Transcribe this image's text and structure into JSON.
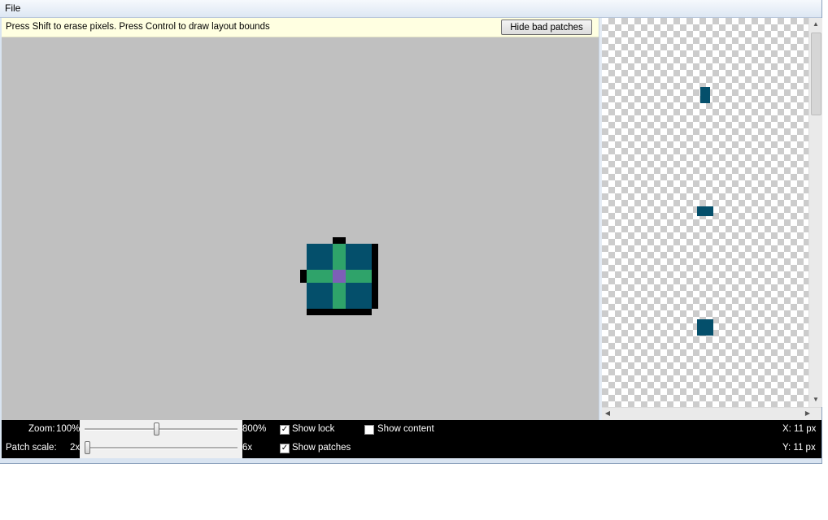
{
  "menu": {
    "file": "File"
  },
  "hint": {
    "text": "Press Shift to erase pixels. Press Control to draw layout bounds",
    "hide_bad_patches": "Hide bad patches"
  },
  "status": {
    "zoom_label": "Zoom:",
    "zoom_min": "100%",
    "zoom_max": "800%",
    "zoom_value_fraction": 0.47,
    "patch_scale_label": "Patch scale:",
    "patch_min": "2x",
    "patch_max": "6x",
    "patch_value_fraction": 0.0,
    "show_lock": {
      "label": "Show lock",
      "checked": true
    },
    "show_content": {
      "label": "Show content",
      "checked": false
    },
    "show_patches": {
      "label": "Show patches",
      "checked": true
    },
    "x_readout": "X: 11 px",
    "y_readout": "Y: 11 px"
  },
  "colors": {
    "patch_dark": "#044f6b",
    "patch_green": "#2fa36a",
    "patch_center": "#7d5fb7",
    "marker": "#000000",
    "editor_bg": "#c0c0c0"
  },
  "icons": {
    "scroll_up": "scroll-up-arrow-icon",
    "scroll_down": "scroll-down-arrow-icon",
    "scroll_left": "scroll-left-arrow-icon",
    "scroll_right": "scroll-right-arrow-icon",
    "checkbox": "checkbox-icon"
  }
}
